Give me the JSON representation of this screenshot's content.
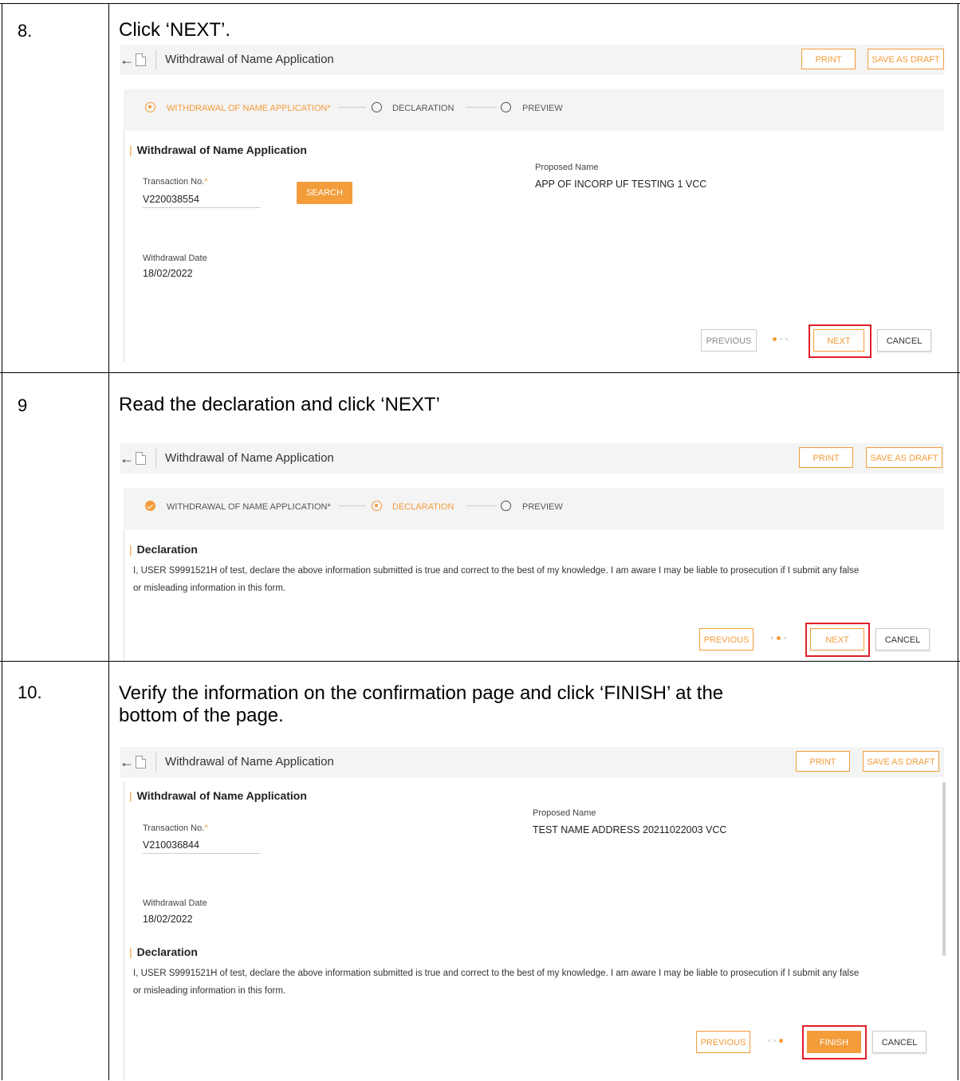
{
  "steps": [
    {
      "number": "8.",
      "instruction": "Click ‘NEXT’.",
      "screen": {
        "title": "Withdrawal of Name Application",
        "print": "PRINT",
        "save_draft": "SAVE AS DRAFT",
        "stepper": {
          "s1": "WITHDRAWAL OF NAME APPLICATION",
          "s2": "DECLARATION",
          "s3": "PREVIEW",
          "req_mark": "*"
        },
        "section": "Withdrawal of Name Application",
        "transaction_label": "Transaction No.",
        "transaction_req": "*",
        "transaction_value": "V220038554",
        "search": "SEARCH",
        "proposed_label": "Proposed Name",
        "proposed_value": "APP OF INCORP UF TESTING 1 VCC",
        "withdrawal_label": "Withdrawal Date",
        "withdrawal_value": "18/02/2022",
        "previous": "PREVIOUS",
        "next": "NEXT",
        "cancel": "CANCEL"
      }
    },
    {
      "number": "9",
      "instruction": "Read the declaration and click ‘NEXT’",
      "screen": {
        "title": "Withdrawal of Name Application",
        "print": "PRINT",
        "save_draft": "SAVE AS DRAFT",
        "stepper": {
          "s1": "WITHDRAWAL OF NAME APPLICATION",
          "s2": "DECLARATION",
          "s3": "PREVIEW",
          "req_mark": "*"
        },
        "section": "Declaration",
        "declaration_line1": "I, USER S9991521H of test, declare the above information submitted is true and correct to the best of my knowledge. I am aware I may be liable to prosecution if I submit any false",
        "declaration_line2": "or misleading information in this form.",
        "previous": "PREVIOUS",
        "next": "NEXT",
        "cancel": "CANCEL"
      }
    },
    {
      "number": "10.",
      "instruction_line1": "Verify the information on the confirmation page and click ‘FINISH’ at the",
      "instruction_line2": "bottom of the page.",
      "screen": {
        "title": "Withdrawal of Name Application",
        "print": "PRINT",
        "save_draft": "SAVE AS DRAFT",
        "section": "Withdrawal of Name Application",
        "transaction_label": "Transaction No.",
        "transaction_req": "*",
        "transaction_value": "V210036844",
        "proposed_label": "Proposed Name",
        "proposed_value": "TEST NAME ADDRESS 20211022003 VCC",
        "withdrawal_label": "Withdrawal Date",
        "withdrawal_value": "18/02/2022",
        "section2": "Declaration",
        "declaration_line1": "I, USER S9991521H of test, declare the above information submitted is true and correct to the best of my knowledge. I am aware I may be liable to prosecution if I submit any false",
        "declaration_line2": "or misleading information in this form.",
        "previous": "PREVIOUS",
        "finish": "FINISH",
        "cancel": "CANCEL"
      }
    }
  ],
  "colors": {
    "accent": "#f39c3a",
    "highlight": "#e0202a"
  }
}
